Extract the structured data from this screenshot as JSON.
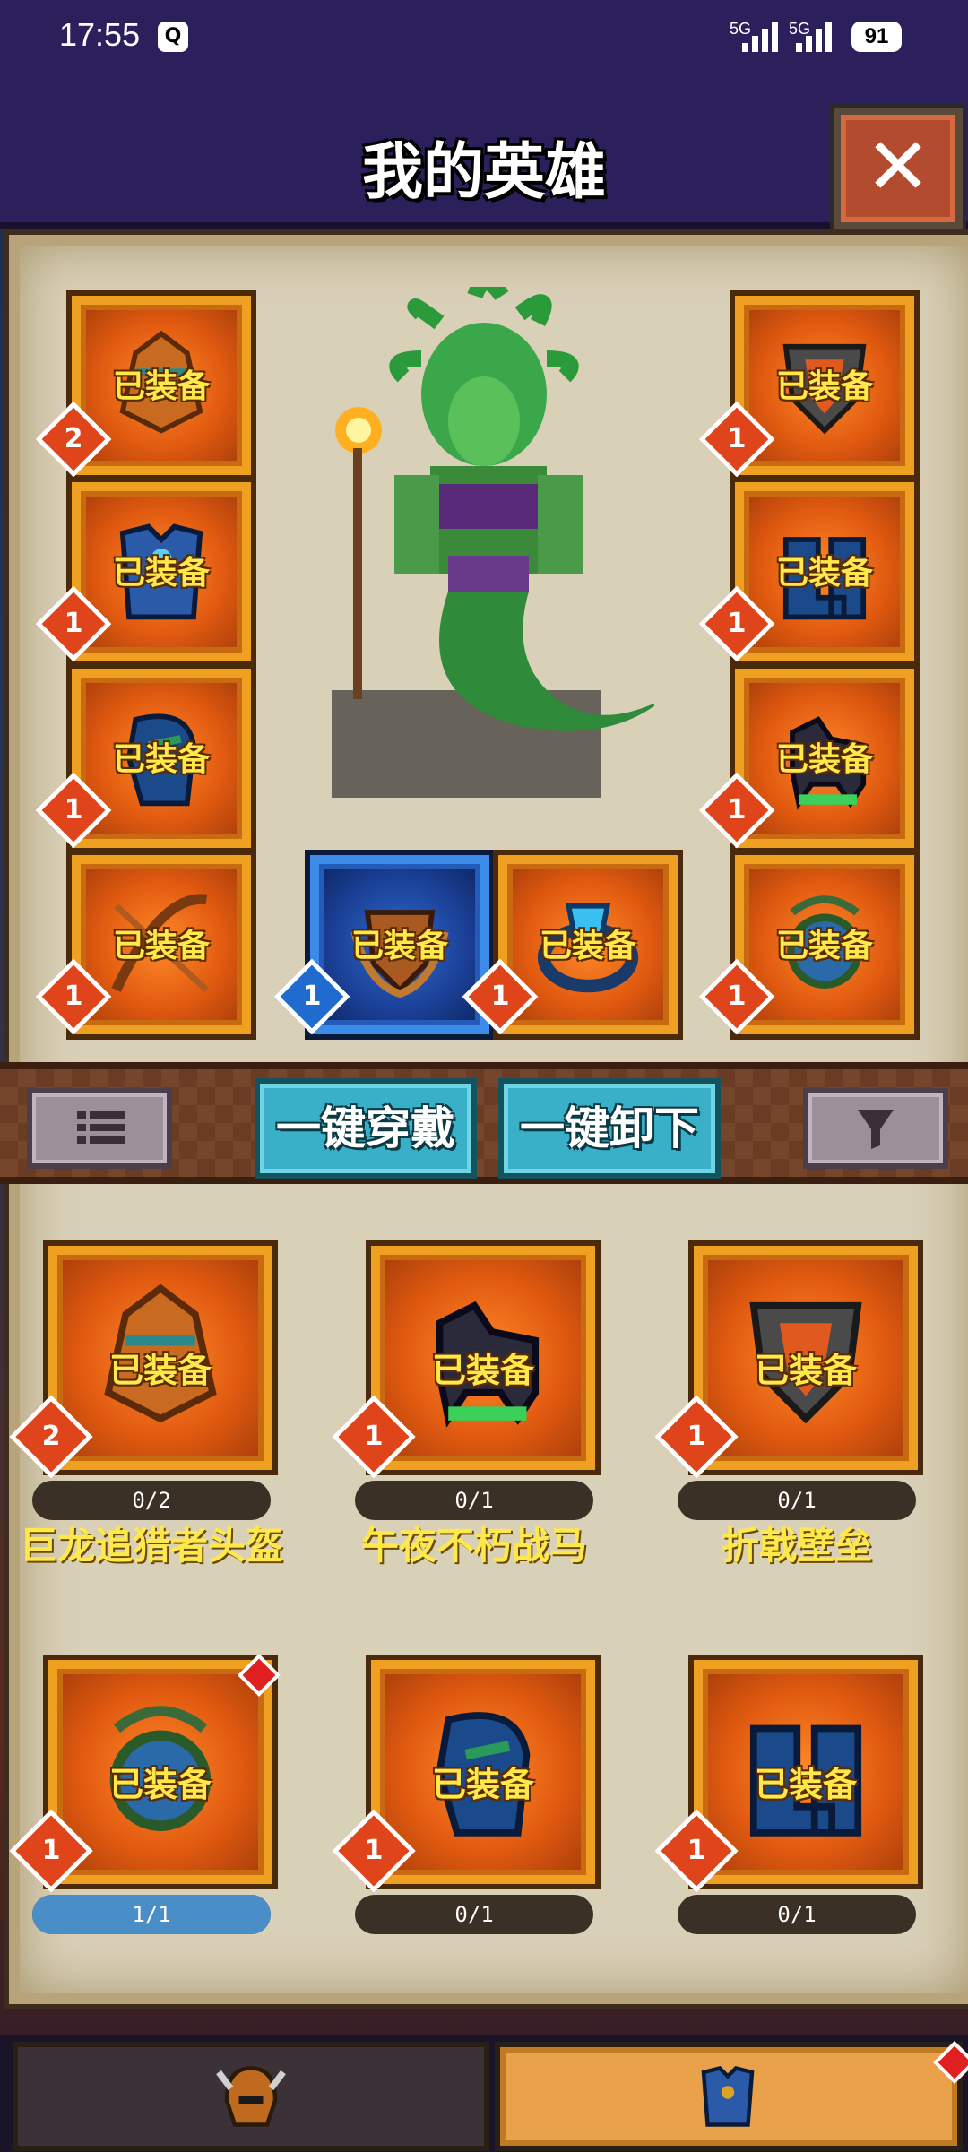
{
  "status_bar": {
    "time": "17:55",
    "qq_icon": "qq-icon",
    "signal1": "5G",
    "signal2": "5G",
    "battery": "91"
  },
  "header": {
    "title": "我的英雄",
    "close_icon": "close-icon"
  },
  "equipped_slots": [
    {
      "icon": "dragon-helmet-icon",
      "label": "已装备",
      "count": "2"
    },
    {
      "icon": "shield-icon",
      "label": "已装备",
      "count": "1"
    },
    {
      "icon": "armor-icon",
      "label": "已装备",
      "count": "1"
    },
    {
      "icon": "boots-icon",
      "label": "已装备",
      "count": "1"
    },
    {
      "icon": "gauntlet-icon",
      "label": "已装备",
      "count": "1"
    },
    {
      "icon": "horse-icon",
      "label": "已装备",
      "count": "1"
    },
    {
      "icon": "bow-icon",
      "label": "已装备",
      "count": "1"
    },
    {
      "icon": "crest-icon",
      "label": "已装备",
      "count": "1"
    },
    {
      "icon": "ring-icon",
      "label": "已装备",
      "count": "1"
    },
    {
      "icon": "amulet-icon",
      "label": "已装备",
      "count": "1"
    }
  ],
  "toolbar": {
    "list_icon": "list-icon",
    "wear_all": "一键穿戴",
    "remove_all": "一键卸下",
    "filter_icon": "filter-icon"
  },
  "items": [
    {
      "name": "巨龙追猎者头盔",
      "label": "已装备",
      "count": "2",
      "progress": "0/2",
      "fill": 0
    },
    {
      "name": "午夜不朽战马",
      "label": "已装备",
      "count": "1",
      "progress": "0/1",
      "fill": 0
    },
    {
      "name": "折戟壁垒",
      "label": "已装备",
      "count": "1",
      "progress": "0/1",
      "fill": 0
    },
    {
      "name": "",
      "label": "已装备",
      "count": "1",
      "progress": "1/1",
      "fill": 1
    },
    {
      "name": "",
      "label": "已装备",
      "count": "1",
      "progress": "0/1",
      "fill": 0
    },
    {
      "name": "",
      "label": "已装备",
      "count": "1",
      "progress": "0/1",
      "fill": 0
    }
  ],
  "bottom_tabs": [
    {
      "icon": "helmet-icon",
      "selected": false
    },
    {
      "icon": "armor-icon",
      "selected": true
    }
  ]
}
